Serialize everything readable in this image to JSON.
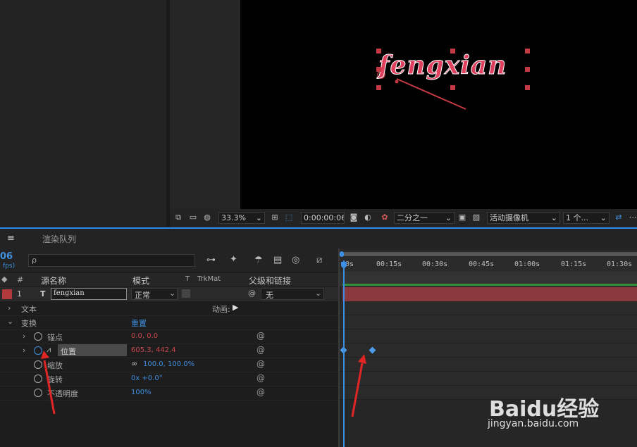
{
  "viewer": {
    "text_layer": "fengxian",
    "zoom": "33.3%",
    "timecode": "0:00:00:06",
    "resolution": "二分之一",
    "camera": "活动摄像机",
    "views": "1 个..."
  },
  "panel": {
    "menu_icon": "≡",
    "tab_render_queue": "渲染队列",
    "fps_value": "06",
    "fps_label": "fps)",
    "search_glyph": "ρ",
    "search_placeholder": ""
  },
  "columns": {
    "number": "#",
    "source_name": "源名称",
    "mode": "模式",
    "t": "T",
    "trkmat": "TrkMat",
    "parent": "父级和链接"
  },
  "layer": {
    "index": "1",
    "type_glyph": "T",
    "name": "fengxian",
    "mode": "正常",
    "parent": "无"
  },
  "properties": {
    "text_group": "文本",
    "animate_label": "动画:",
    "transform_group": "变换",
    "reset_label": "重置",
    "anchor_label": "锚点",
    "anchor_value": "0.0, 0.0",
    "position_label": "位置",
    "position_value": "605.3, 442.4",
    "scale_label": "缩放",
    "scale_value": "100.0, 100.0%",
    "rotation_label": "旋转",
    "rotation_value": "0x +0.0°",
    "opacity_label": "不透明度",
    "opacity_value": "100%"
  },
  "timeline": {
    "ticks": [
      "0s",
      "00:15s",
      "00:30s",
      "00:45s",
      "01:00s",
      "01:15s",
      "01:30s"
    ]
  },
  "watermark": {
    "brand": "Baidu经验",
    "url": "jingyan.baidu.com"
  },
  "colors": {
    "accent_blue": "#2d8ceb",
    "layer_red": "#8a3a3d",
    "value_red": "#c9484e",
    "value_blue": "#3f8fe0"
  }
}
